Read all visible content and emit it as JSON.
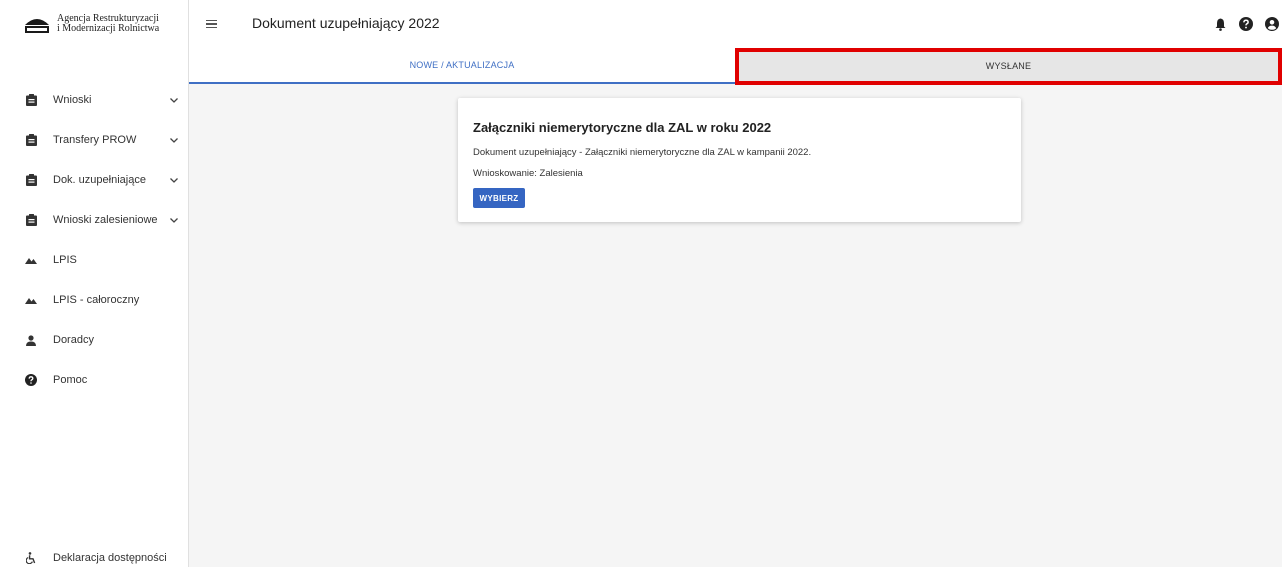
{
  "brand": {
    "line1": "Agencja Restrukturyzacji",
    "line2": "i Modernizacji Rolnictwa"
  },
  "header": {
    "title": "Dokument uzupełniający 2022"
  },
  "tabs": [
    {
      "label": "NOWE / AKTUALIZACJA",
      "active": true
    },
    {
      "label": "WYSŁANE",
      "active": false
    }
  ],
  "sidebar": {
    "items": [
      {
        "label": "Wnioski",
        "icon": "clipboard-icon",
        "expandable": true
      },
      {
        "label": "Transfery PROW",
        "icon": "clipboard-icon",
        "expandable": true
      },
      {
        "label": "Dok. uzupełniające",
        "icon": "clipboard-icon",
        "expandable": true
      },
      {
        "label": "Wnioski zalesieniowe",
        "icon": "clipboard-icon",
        "expandable": true
      },
      {
        "label": "LPIS",
        "icon": "terrain-icon",
        "expandable": false
      },
      {
        "label": "LPIS - całoroczny",
        "icon": "terrain-icon",
        "expandable": false
      },
      {
        "label": "Doradcy",
        "icon": "person-icon",
        "expandable": false
      },
      {
        "label": "Pomoc",
        "icon": "help-icon",
        "expandable": false
      }
    ],
    "footer": {
      "label": "Deklaracja dostępności",
      "icon": "accessibility-icon"
    }
  },
  "card": {
    "title": "Załączniki niemerytoryczne dla ZAL w roku 2022",
    "description": "Dokument uzupełniający - Załączniki niemerytoryczne dla ZAL w kampanii 2022.",
    "meta": "Wnioskowanie: Zalesienia",
    "button": "WYBIERZ"
  },
  "colors": {
    "accent": "#3f6fc4",
    "button": "#3565c2",
    "highlight": "#e00000",
    "background": "#f5f5f5"
  }
}
